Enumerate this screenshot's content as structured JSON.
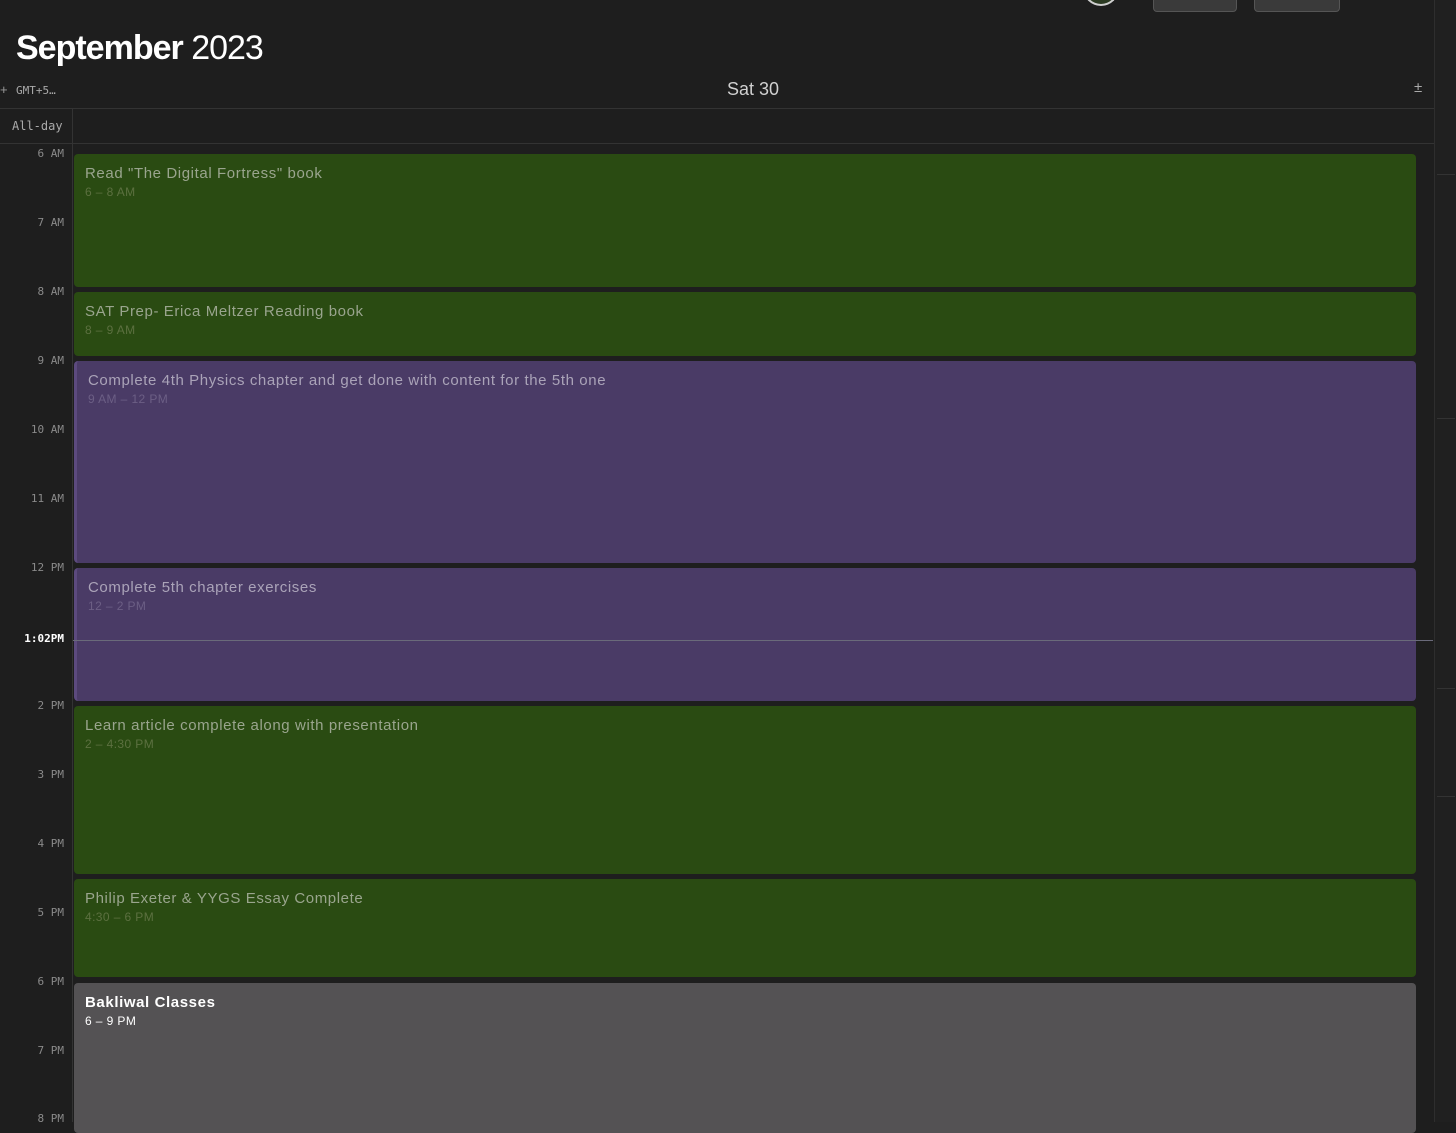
{
  "header": {
    "month": "September",
    "year": "2023"
  },
  "columns": {
    "timezone": "GMT+5…",
    "day": "Sat 30",
    "all_day": "All-day",
    "add_icon": "plus-minus-icon"
  },
  "hours": [
    "6 AM",
    "7 AM",
    "8 AM",
    "9 AM",
    "10 AM",
    "11 AM",
    "12 PM",
    "2 PM",
    "3 PM",
    "4 PM",
    "5 PM",
    "6 PM",
    "7 PM",
    "8 PM"
  ],
  "current_time": "1:02PM",
  "events": [
    {
      "title": "Read \"The Digital Fortress\" book",
      "time": "6 – 8 AM",
      "color": "#2a4b12"
    },
    {
      "title": "SAT Prep- Erica Meltzer Reading book",
      "time": "8 – 9 AM",
      "color": "#2a4b12"
    },
    {
      "title": "Complete 4th Physics chapter and get done with content for the 5th one",
      "time": "9 AM – 12 PM",
      "color": "#4a3b66"
    },
    {
      "title": "Complete 5th chapter exercises",
      "time": "12 – 2 PM",
      "color": "#4a3b66"
    },
    {
      "title": "Learn article complete along with presentation",
      "time": "2 – 4:30 PM",
      "color": "#2a4b12"
    },
    {
      "title": "Philip Exeter & YYGS Essay Complete",
      "time": "4:30 – 6 PM",
      "color": "#2a4b12"
    },
    {
      "title": "Bakliwal Classes",
      "time": "6 – 9 PM",
      "color": "#545254"
    }
  ]
}
